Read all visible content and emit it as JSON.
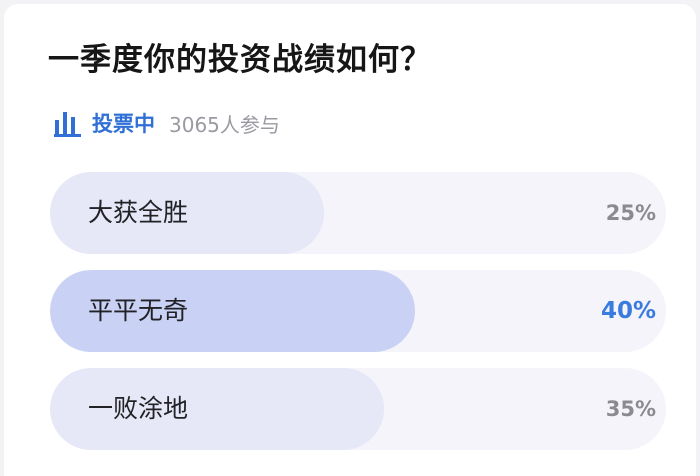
{
  "poll": {
    "title": "一季度你的投资战绩如何？",
    "status_label": "投票中",
    "participants": "3065人参与",
    "icon": "bar-chart-icon",
    "accent_color": "#2f6fd6",
    "options": [
      {
        "label": "大获全胜",
        "percent_label": "25%",
        "share": 0.25,
        "selected": false
      },
      {
        "label": "平平无奇",
        "percent_label": "40%",
        "share": 0.4,
        "selected": true
      },
      {
        "label": "一败涂地",
        "percent_label": "35%",
        "share": 0.35,
        "selected": false
      }
    ]
  }
}
